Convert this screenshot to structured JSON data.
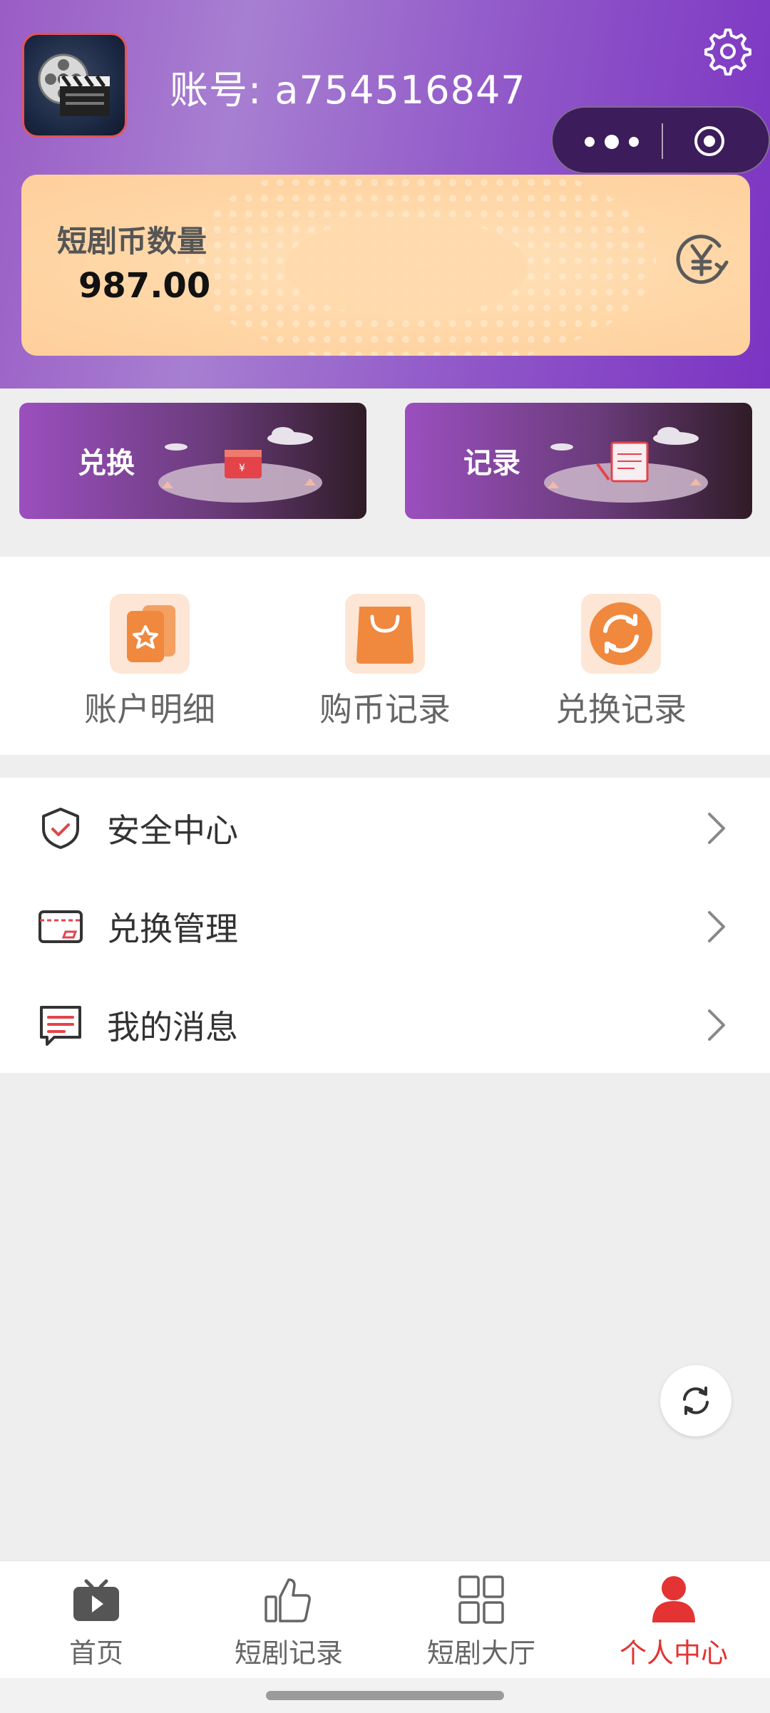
{
  "header": {
    "account_label": "账号: a754516847",
    "avatar_icon": "film-clapper-avatar",
    "settings_icon": "gear-icon",
    "capsule": {
      "more_icon": "more-dots-icon",
      "close_icon": "target-icon"
    }
  },
  "coin_card": {
    "label": "短剧币数量",
    "value": "987.00",
    "icon": "yen-exchange-icon"
  },
  "banners": [
    {
      "label": "兑换",
      "icon": "red-box-illustration"
    },
    {
      "label": "记录",
      "icon": "notebook-illustration"
    }
  ],
  "quick_links": [
    {
      "label": "账户明细",
      "icon": "card-star-icon"
    },
    {
      "label": "购币记录",
      "icon": "shopping-bag-icon"
    },
    {
      "label": "兑换记录",
      "icon": "refresh-circle-icon"
    }
  ],
  "menu": [
    {
      "label": "安全中心",
      "icon": "shield-check-icon"
    },
    {
      "label": "兑换管理",
      "icon": "card-icon"
    },
    {
      "label": "我的消息",
      "icon": "message-icon"
    }
  ],
  "floating": {
    "icon": "refresh-icon"
  },
  "tabbar": [
    {
      "label": "首页",
      "icon": "tv-play-icon",
      "active": false
    },
    {
      "label": "短剧记录",
      "icon": "thumb-up-icon",
      "active": false
    },
    {
      "label": "短剧大厅",
      "icon": "grid-icon",
      "active": false
    },
    {
      "label": "个人中心",
      "icon": "person-icon",
      "active": true
    }
  ],
  "colors": {
    "accent": "#e33333",
    "header_purple": "#9a5cc6",
    "card_peach": "#ffd6a6",
    "icon_orange": "#f0883e"
  }
}
